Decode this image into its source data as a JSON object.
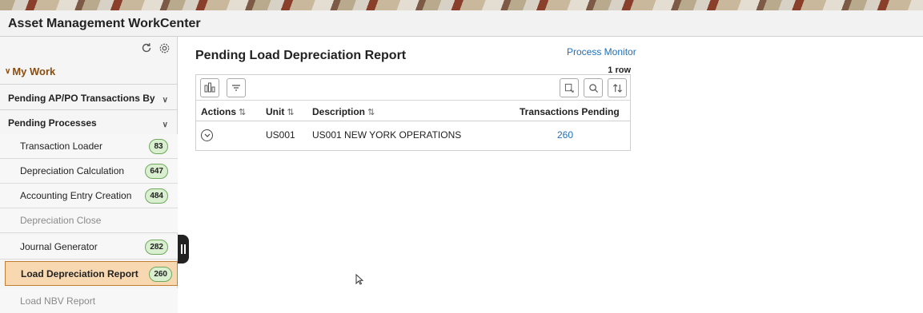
{
  "app": {
    "title": "Asset Management WorkCenter"
  },
  "sidebar": {
    "section": "My Work",
    "groups": [
      {
        "label": "Pending AP/PO Transactions By"
      },
      {
        "label": "Pending Processes"
      }
    ],
    "items": [
      {
        "label": "Transaction Loader",
        "count": "83"
      },
      {
        "label": "Depreciation Calculation",
        "count": "647"
      },
      {
        "label": "Accounting Entry Creation",
        "count": "484"
      },
      {
        "label": "Depreciation Close",
        "count": ""
      },
      {
        "label": "Journal Generator",
        "count": "282"
      },
      {
        "label": "Load Depreciation Report",
        "count": "260"
      },
      {
        "label": "Load NBV Report",
        "count": ""
      }
    ]
  },
  "main": {
    "title": "Pending Load Depreciation Report",
    "process_monitor": "Process Monitor",
    "row_count": "1 row",
    "columns": {
      "actions": "Actions",
      "unit": "Unit",
      "description": "Description",
      "pending": "Transactions Pending"
    },
    "rows": [
      {
        "unit": "US001",
        "description": "US001 NEW YORK OPERATIONS",
        "pending": "260"
      }
    ]
  },
  "colors": {
    "accent_link": "#1f6eb8",
    "selected_bg": "#f7d8b0",
    "badge_bg": "#d9efd0",
    "section_label": "#8a4d10"
  },
  "icons": [
    "refresh-icon",
    "gear-icon",
    "chevron-down-icon",
    "chart-icon",
    "filter-icon",
    "export-icon",
    "search-icon",
    "sort-icon",
    "row-actions-icon",
    "collapse-handle-icon"
  ]
}
